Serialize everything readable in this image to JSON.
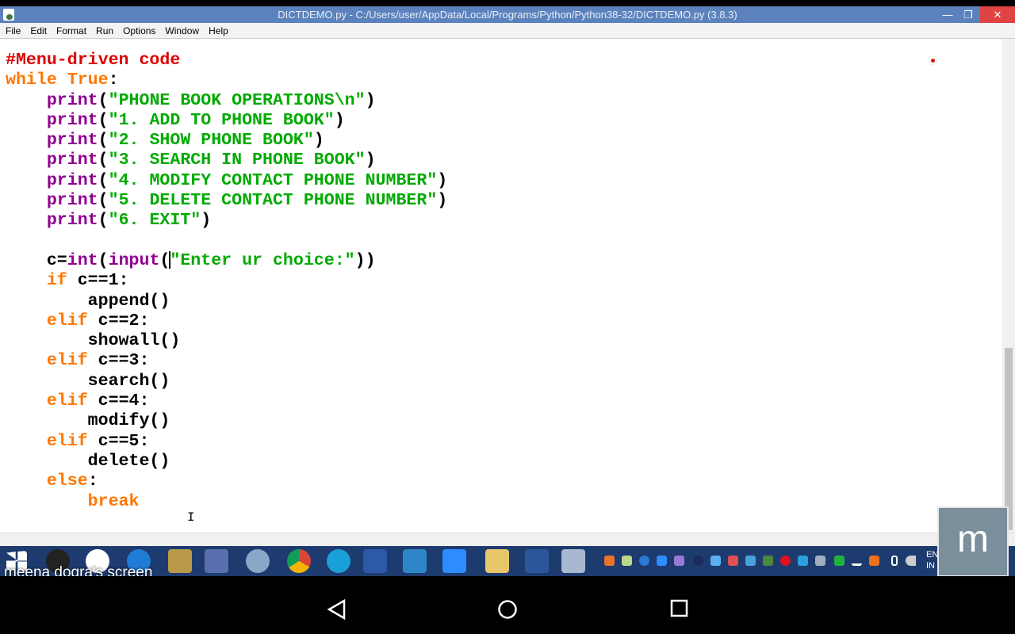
{
  "window": {
    "title": "DICTDEMO.py - C:/Users/user/AppData/Local/Programs/Python/Python38-32/DICTDEMO.py (3.8.3)",
    "minimize": "—",
    "maximize": "❐",
    "close": "✕"
  },
  "menu": [
    "File",
    "Edit",
    "Format",
    "Run",
    "Options",
    "Window",
    "Help"
  ],
  "code": [
    [
      [
        "c",
        "#Menu-driven code"
      ]
    ],
    [
      [
        "k",
        "while"
      ],
      [
        "n",
        " "
      ],
      [
        "k",
        "True"
      ],
      [
        "n",
        ":"
      ]
    ],
    [
      [
        "n",
        "    "
      ],
      [
        "b",
        "print"
      ],
      [
        "n",
        "("
      ],
      [
        "s",
        "\"PHONE BOOK OPERATIONS\\n\""
      ],
      [
        "n",
        ")"
      ]
    ],
    [
      [
        "n",
        "    "
      ],
      [
        "b",
        "print"
      ],
      [
        "n",
        "("
      ],
      [
        "s",
        "\"1. ADD TO PHONE BOOK\""
      ],
      [
        "n",
        ")"
      ]
    ],
    [
      [
        "n",
        "    "
      ],
      [
        "b",
        "print"
      ],
      [
        "n",
        "("
      ],
      [
        "s",
        "\"2. SHOW PHONE BOOK\""
      ],
      [
        "n",
        ")"
      ]
    ],
    [
      [
        "n",
        "    "
      ],
      [
        "b",
        "print"
      ],
      [
        "n",
        "("
      ],
      [
        "s",
        "\"3. SEARCH IN PHONE BOOK\""
      ],
      [
        "n",
        ")"
      ]
    ],
    [
      [
        "n",
        "    "
      ],
      [
        "b",
        "print"
      ],
      [
        "n",
        "("
      ],
      [
        "s",
        "\"4. MODIFY CONTACT PHONE NUMBER\""
      ],
      [
        "n",
        ")"
      ]
    ],
    [
      [
        "n",
        "    "
      ],
      [
        "b",
        "print"
      ],
      [
        "n",
        "("
      ],
      [
        "s",
        "\"5. DELETE CONTACT PHONE NUMBER\""
      ],
      [
        "n",
        ")"
      ]
    ],
    [
      [
        "n",
        "    "
      ],
      [
        "b",
        "print"
      ],
      [
        "n",
        "("
      ],
      [
        "s",
        "\"6. EXIT\""
      ],
      [
        "n",
        ")"
      ]
    ],
    [
      [
        "n",
        ""
      ]
    ],
    [
      [
        "n",
        "    c="
      ],
      [
        "b",
        "int"
      ],
      [
        "n",
        "("
      ],
      [
        "b",
        "input"
      ],
      [
        "n",
        "("
      ],
      [
        "cursor",
        ""
      ],
      [
        "s",
        "\"Enter ur choice:\""
      ],
      [
        "n",
        "))"
      ]
    ],
    [
      [
        "n",
        "    "
      ],
      [
        "k",
        "if"
      ],
      [
        "n",
        " c==1:"
      ]
    ],
    [
      [
        "n",
        "        append()"
      ]
    ],
    [
      [
        "n",
        "    "
      ],
      [
        "k",
        "elif"
      ],
      [
        "n",
        " c==2:"
      ]
    ],
    [
      [
        "n",
        "        showall()"
      ]
    ],
    [
      [
        "n",
        "    "
      ],
      [
        "k",
        "elif"
      ],
      [
        "n",
        " c==3:"
      ]
    ],
    [
      [
        "n",
        "        search()"
      ]
    ],
    [
      [
        "n",
        "    "
      ],
      [
        "k",
        "elif"
      ],
      [
        "n",
        " c==4:"
      ]
    ],
    [
      [
        "n",
        "        modify()"
      ]
    ],
    [
      [
        "n",
        "    "
      ],
      [
        "k",
        "elif"
      ],
      [
        "n",
        " c==5:"
      ]
    ],
    [
      [
        "n",
        "        delete()"
      ]
    ],
    [
      [
        "n",
        "    "
      ],
      [
        "k",
        "else"
      ],
      [
        "n",
        ":"
      ]
    ],
    [
      [
        "n",
        "        "
      ],
      [
        "k",
        "break"
      ]
    ]
  ],
  "overlay": {
    "screen_label": "meena dogra's screen",
    "avatar_letter": "m"
  },
  "tray": {
    "lang1": "EN",
    "lang2": "IN"
  },
  "colors": {
    "comment": "#dd0000",
    "keyword": "#ff7700",
    "builtin": "#900090",
    "string": "#00aa00"
  }
}
